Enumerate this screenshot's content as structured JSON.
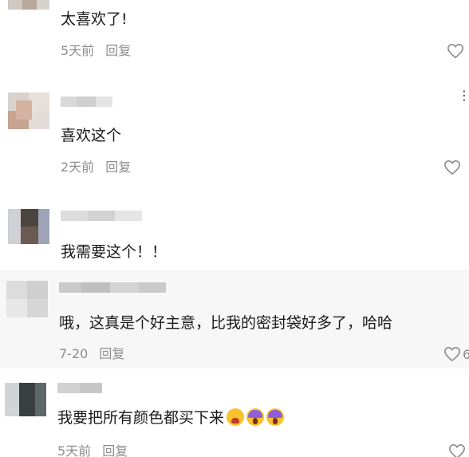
{
  "comments": [
    {
      "text": "太喜欢了!",
      "time": "5天前",
      "reply": "回复",
      "likes": ""
    },
    {
      "text": "喜欢这个",
      "time": "2天前",
      "reply": "回复",
      "likes": ""
    },
    {
      "text": "我需要这个！！",
      "time": "",
      "reply": "",
      "likes": ""
    },
    {
      "text": "哦，这真是个好主意，比我的密封袋好多了，哈哈",
      "time": "7-20",
      "reply": "回复",
      "likes": "6"
    },
    {
      "text": "我要把所有颜色都买下来",
      "time": "5天前",
      "reply": "回复",
      "likes": "",
      "emojis": [
        "tired-face-emoji",
        "screaming-face-emoji",
        "screaming-face-emoji"
      ]
    }
  ],
  "more_menu": "⋮",
  "colors": {
    "meta_gray": "#8e8e8e",
    "text": "#1a1a1a",
    "card_gray": "#f7f7f7"
  }
}
